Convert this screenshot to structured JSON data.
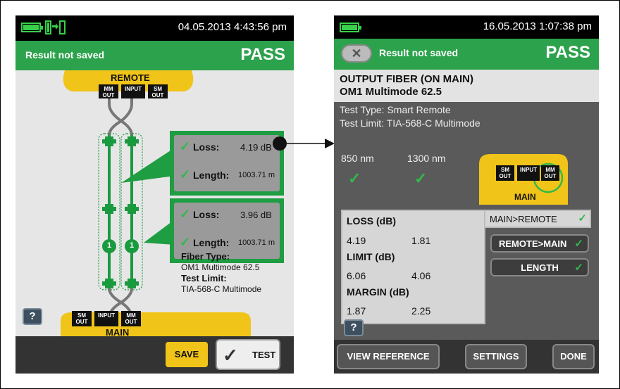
{
  "screen1": {
    "datetime": "04.05.2013 4:43:56 pm",
    "header_left": "Result not saved",
    "header_right": "PASS",
    "remote_label": "REMOTE",
    "remote_ports": [
      "MM OUT",
      "INPUT",
      "SM OUT"
    ],
    "main_label": "MAIN",
    "main_ports": [
      "SM OUT",
      "INPUT",
      "MM OUT"
    ],
    "result1": {
      "loss_label": "Loss:",
      "loss_value": "4.19 dB",
      "length_label": "Length:",
      "length_value": "1003.71 m"
    },
    "result2": {
      "loss_label": "Loss:",
      "loss_value": "3.96 dB",
      "length_label": "Length:",
      "length_value": "1003.71 m"
    },
    "marker_label": "1",
    "fiber_type_label": "Fiber Type:",
    "fiber_type_value": "OM1 Multimode 62.5",
    "test_limit_label": "Test Limit:",
    "test_limit_value": "TIA-568-C Multimode",
    "help_label": "?",
    "save_label": "SAVE",
    "test_label": "TEST"
  },
  "screen2": {
    "datetime": "16.05.2013 1:07:38 pm",
    "header_left": "Result not saved",
    "header_right": "PASS",
    "title_line1": "OUTPUT FIBER (ON MAIN)",
    "title_line2": "OM1 Multimode 62.5",
    "test_type": "Test Type: Smart Remote",
    "test_limit": "Test Limit: TIA-568-C Multimode",
    "wavelength1": "850 nm",
    "wavelength2": "1300 nm",
    "main_label": "MAIN",
    "main_ports": [
      "SM OUT",
      "INPUT",
      "MM OUT"
    ],
    "direction_selected": "MAIN>REMOTE",
    "loss_header": "LOSS (dB)",
    "loss_values": [
      "4.19",
      "1.81"
    ],
    "limit_header": "LIMIT (dB)",
    "limit_values": [
      "6.06",
      "4.06"
    ],
    "margin_header": "MARGIN (dB)",
    "margin_values": [
      "1.87",
      "2.25"
    ],
    "remote_main_label": "REMOTE>MAIN",
    "length_label": "LENGTH",
    "help_label": "?",
    "footer": {
      "view_reference": "VIEW REFERENCE",
      "settings": "SETTINGS",
      "done": "DONE"
    }
  },
  "colors": {
    "header_green": "#2ca24c",
    "check_green": "#32b84b",
    "unit_yellow": "#f0c419",
    "fiber_green": "#1a9a3f"
  }
}
